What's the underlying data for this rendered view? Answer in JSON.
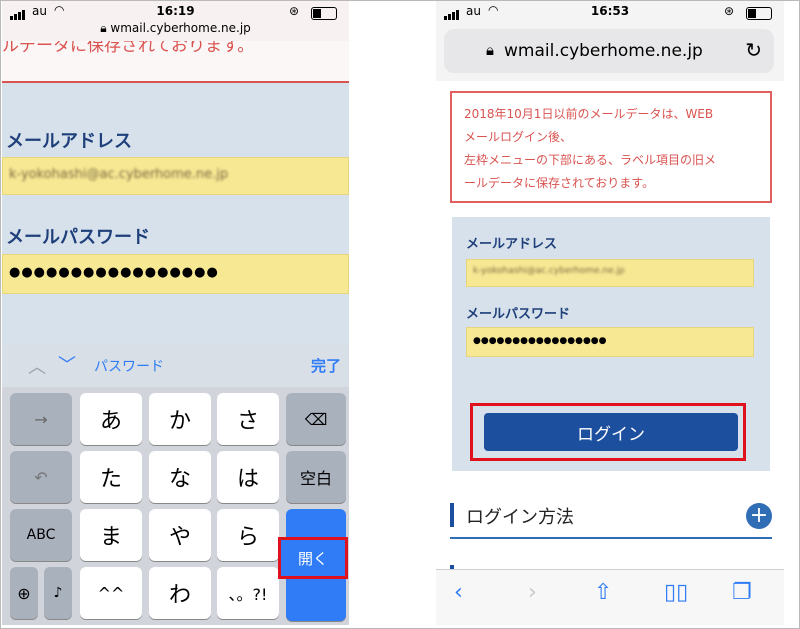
{
  "left": {
    "status": {
      "carrier": "au",
      "time": "16:19"
    },
    "url": "wmail.cyberhome.ne.jp",
    "banner_text": "ルデータに保存されております。",
    "email_label": "メールアドレス",
    "email_value": "k-yokohashi@ac.cyberhome.ne.jp",
    "password_label": "メールパスワード",
    "password_value": "●●●●●●●●●●●●●●●●●",
    "accessory": {
      "field_name": "パスワード",
      "done": "完了"
    },
    "keyboard": {
      "row1": [
        "あ",
        "か",
        "さ"
      ],
      "row2": [
        "た",
        "な",
        "は"
      ],
      "row3": [
        "ま",
        "や",
        "ら"
      ],
      "row4": [
        "^^",
        "わ",
        "、。?!"
      ],
      "space_label": "空白",
      "abc_label": "ABC",
      "open_label": "開く"
    }
  },
  "right": {
    "status": {
      "carrier": "au",
      "time": "16:53"
    },
    "url": "wmail.cyberhome.ne.jp",
    "notice": {
      "line1": "2018年10月1日以前のメールデータは、WEB",
      "line2": "メールログイン後、",
      "line3": "左枠メニューの下部にある、ラベル項目の旧メ",
      "line4": "ールデータに保存されております。"
    },
    "email_label": "メールアドレス",
    "email_value": "k-yokohashi@ac.cyberhome.ne.jp",
    "password_label": "メールパスワード",
    "password_value": "●●●●●●●●●●●●●●●●●",
    "login_button": "ログイン",
    "section_title": "ログイン方法",
    "section_plus": "+"
  },
  "colors": {
    "highlight": "#e0101d",
    "brand_blue": "#1d4f9f",
    "ios_blue": "#2f7cf6",
    "notice_red": "#d9534f",
    "field_yellow": "#f7e894"
  }
}
